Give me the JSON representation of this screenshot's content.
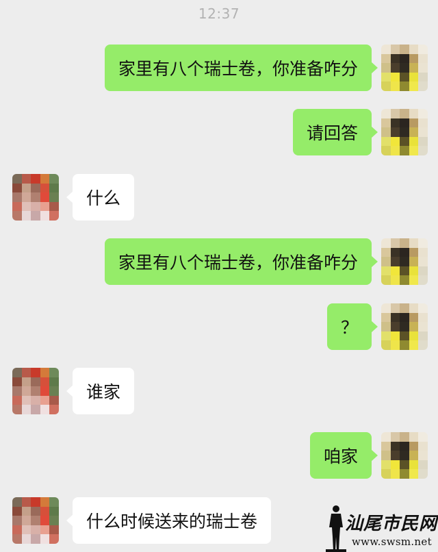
{
  "chat": {
    "timestamp": "12:37",
    "messages": [
      {
        "side": "out",
        "text": "家里有八个瑞士卷，你准备咋分"
      },
      {
        "side": "out",
        "text": "请回答"
      },
      {
        "side": "in",
        "text": "什么"
      },
      {
        "side": "out",
        "text": "家里有八个瑞士卷，你准备咋分"
      },
      {
        "side": "out",
        "text": "？"
      },
      {
        "side": "in",
        "text": "谁家"
      },
      {
        "side": "out",
        "text": "咱家"
      },
      {
        "side": "in",
        "text": "什么时候送来的瑞士卷"
      }
    ]
  },
  "watermark": {
    "name": "汕尾市民网",
    "url": "www.swsm.net"
  },
  "colors": {
    "background": "#ededed",
    "outgoing_bubble": "#95ec69",
    "incoming_bubble": "#ffffff",
    "timestamp": "#b2b2b2"
  }
}
